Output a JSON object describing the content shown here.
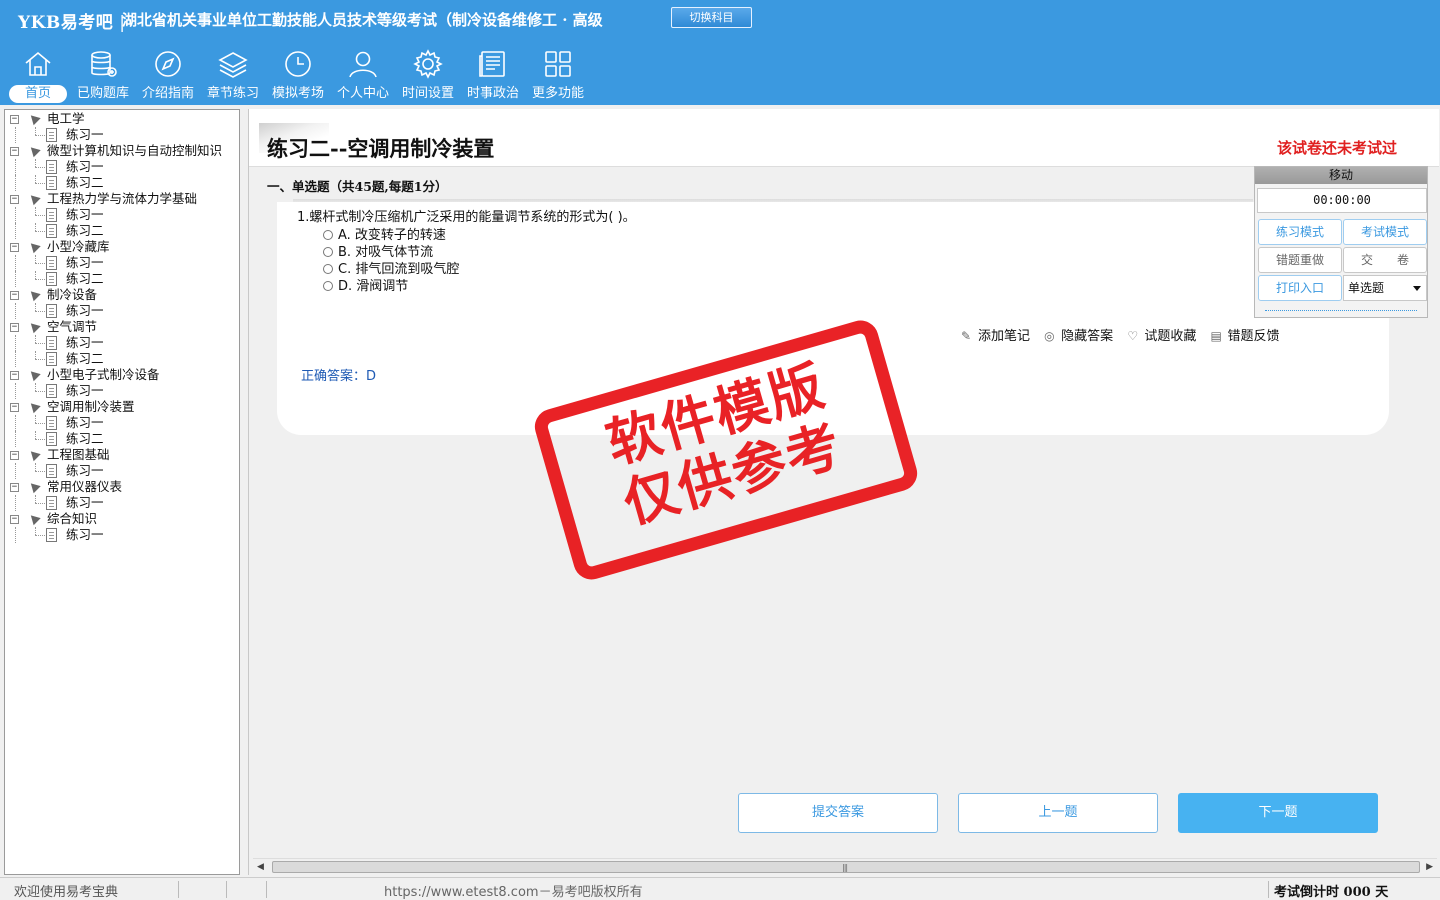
{
  "header": {
    "brand": "YKB易考吧",
    "separator": "|",
    "title": "湖北省机关事业单位工勤技能人员技术等级考试（制冷设备维修工 · 高级",
    "switch_subject": "切换科目",
    "bg_color": "#3b99e0"
  },
  "nav": [
    {
      "label": "首页",
      "icon": "home-icon",
      "active": true
    },
    {
      "label": "已购题库",
      "icon": "database-icon"
    },
    {
      "label": "介绍指南",
      "icon": "compass-icon"
    },
    {
      "label": "章节练习",
      "icon": "layers-icon"
    },
    {
      "label": "模拟考场",
      "icon": "clock-icon"
    },
    {
      "label": "个人中心",
      "icon": "user-icon"
    },
    {
      "label": "时间设置",
      "icon": "gear-icon"
    },
    {
      "label": "时事政治",
      "icon": "news-icon"
    },
    {
      "label": "更多功能",
      "icon": "grid-icon"
    }
  ],
  "tree": [
    {
      "label": "电工学",
      "children": [
        "练习一"
      ]
    },
    {
      "label": "微型计算机知识与自动控制知识",
      "children": [
        "练习一",
        "练习二"
      ]
    },
    {
      "label": "工程热力学与流体力学基础",
      "children": [
        "练习一",
        "练习二"
      ]
    },
    {
      "label": "小型冷藏库",
      "children": [
        "练习一",
        "练习二"
      ]
    },
    {
      "label": "制冷设备",
      "children": [
        "练习一"
      ]
    },
    {
      "label": "空气调节",
      "children": [
        "练习一",
        "练习二"
      ]
    },
    {
      "label": "小型电子式制冷设备",
      "children": [
        "练习一"
      ]
    },
    {
      "label": "空调用制冷装置",
      "children": [
        "练习一",
        "练习二"
      ]
    },
    {
      "label": "工程图基础",
      "children": [
        "练习一"
      ]
    },
    {
      "label": "常用仪器仪表",
      "children": [
        "练习一"
      ]
    },
    {
      "label": "综合知识",
      "children": [
        "练习一"
      ]
    }
  ],
  "exercise": {
    "title": "练习二--空调用制冷装置",
    "status": "该试卷还未考试过",
    "section": "一、单选题（共45题,每题1分）"
  },
  "question": {
    "text": "1.螺杆式制冷压缩机广泛采用的能量调节系统的形式为( )。",
    "options": [
      "A. 改变转子的转速",
      "B. 对吸气体节流",
      "C. 排气回流到吸气腔",
      "D. 滑阀调节"
    ],
    "actions": [
      {
        "label": "添加笔记",
        "icon": "pencil-icon"
      },
      {
        "label": "隐藏答案",
        "icon": "eye-off-icon"
      },
      {
        "label": "试题收藏",
        "icon": "heart-icon"
      },
      {
        "label": "错题反馈",
        "icon": "feedback-icon"
      }
    ],
    "answer_label": "正确答案：",
    "answer_value": "D"
  },
  "tools": {
    "move": "移动",
    "timer": "00:00:00",
    "practice_mode": "练习模式",
    "exam_mode": "考试模式",
    "redo_wrong": "错题重做",
    "submit_paper": "交　　卷",
    "print_entry": "打印入口",
    "question_type": "单选题"
  },
  "watermark": {
    "line1": "软件模版",
    "line2": "仅供参考"
  },
  "buttons": {
    "submit_answer": "提交答案",
    "prev": "上一题",
    "next": "下一题"
  },
  "statusbar": {
    "welcome": "欢迎使用易考宝典",
    "copyright": "https://www.etest8.com－易考吧版权所有",
    "countdown": "考试倒计时 000 天"
  }
}
